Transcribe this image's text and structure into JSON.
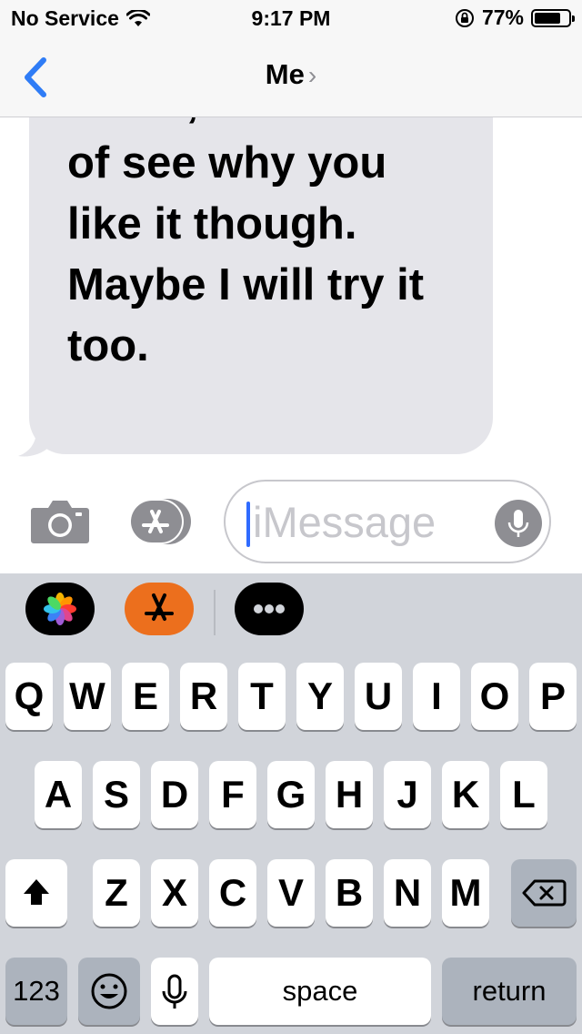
{
  "status_bar": {
    "carrier": "No Service",
    "time": "9:17 PM",
    "battery_percent": "77%",
    "battery_level": 0.77
  },
  "nav": {
    "contact_name": "Me",
    "chevron": "›"
  },
  "message": {
    "text_lines": [
      "mous, I can kind",
      "of see why you",
      "like it though.",
      "Maybe I will try it",
      "too."
    ]
  },
  "input": {
    "placeholder": "iMessage"
  },
  "app_strip": {
    "apps": [
      "photos-app-icon",
      "app-store-app-icon",
      "more-apps-icon"
    ]
  },
  "keyboard": {
    "row1": [
      "Q",
      "W",
      "E",
      "R",
      "T",
      "Y",
      "U",
      "I",
      "O",
      "P"
    ],
    "row2": [
      "A",
      "S",
      "D",
      "F",
      "G",
      "H",
      "J",
      "K",
      "L"
    ],
    "row3": [
      "Z",
      "X",
      "C",
      "V",
      "B",
      "N",
      "M"
    ],
    "numbers_label": "123",
    "space_label": "space",
    "return_label": "return"
  },
  "colors": {
    "accent": "#2f7cf6",
    "bubble_gray": "#e5e5ea",
    "keyboard_bg": "#d1d4da",
    "function_key": "#acb3bd"
  }
}
